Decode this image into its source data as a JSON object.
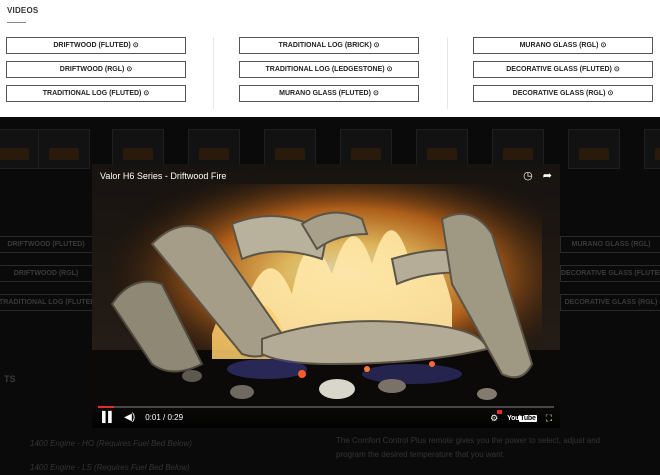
{
  "videos": {
    "title": "VIDEOS",
    "columns": [
      [
        "DRIFTWOOD (FLUTED)",
        "DRIFTWOOD (RGL)",
        "TRADITIONAL LOG (FLUTED)"
      ],
      [
        "TRADITIONAL LOG (BRICK)",
        "TRADITIONAL LOG (LEDGESTONE)",
        "MURANO GLASS (FLUTED)"
      ],
      [
        "MURANO GLASS (RGL)",
        "DECORATIVE GLASS (FLUTED)",
        "DECORATIVE GLASS (RGL)"
      ]
    ],
    "play_icon": "play-circle-icon"
  },
  "player": {
    "title": "Valor H6 Series - Driftwood Fire",
    "time": "0:01 / 0:29",
    "progress_fraction": 0.034,
    "icons": [
      "clock-icon",
      "share-icon",
      "pause-icon",
      "volume-icon",
      "settings-icon",
      "youtube-logo",
      "fullscreen-icon"
    ],
    "youtube_label": "You",
    "youtube_tube": "Tube",
    "accent": "#e52d27"
  },
  "background": {
    "buttons_left": [
      "DRIFTWOOD (FLUTED)",
      "DRIFTWOOD (RGL)",
      "TRADITIONAL LOG (FLUTED)"
    ],
    "buttons_right": [
      "MURANO GLASS (RGL)",
      "DECORATIVE GLASS (FLUTED)",
      "DECORATIVE GLASS (RGL)"
    ],
    "section_head": "TS",
    "engine_lines": [
      "1400 Engine - HO (Requires Fuel Bed Below)",
      "1400 Engine - LS (Requires Fuel Bed Below)"
    ],
    "body_lines": [
      "The Comfort Control Plus remote gives you the power to select, adjust and",
      "program the desired temperature that you want."
    ]
  }
}
